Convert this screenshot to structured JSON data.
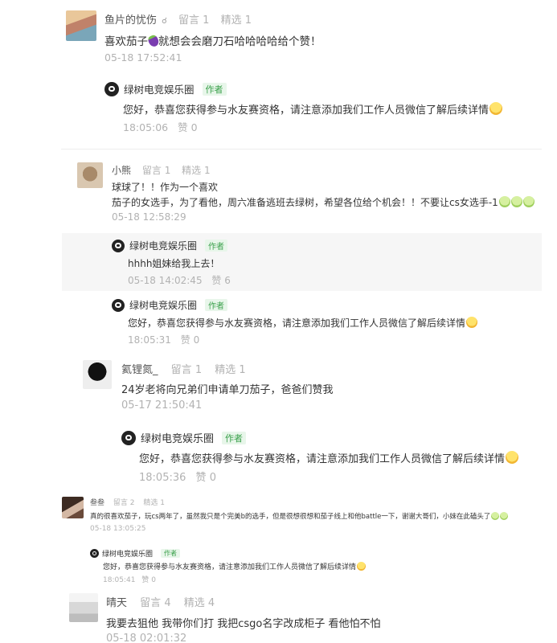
{
  "labels": {
    "comment_count_prefix": "留言",
    "featured_prefix": "精选",
    "like_prefix": "赞"
  },
  "colors": {
    "author_tag_green": "#3aa04b",
    "meta_gray": "#b2b2b2",
    "highlight_bg": "#f6f6f6"
  },
  "comments": [
    {
      "nickname": "鱼片的忧伤",
      "nickname_badge": "glasses-icon",
      "comment_count": "1",
      "featured_count": "1",
      "text": "喜欢茄子",
      "text_emoji": "eggplant-icon",
      "text_after": "就想会会磨刀石哈哈哈哈给个赞！",
      "time": "05-18 17:52:41",
      "replies": [
        {
          "author": "绿树电竞娱乐圈",
          "tag": "作者",
          "text": "您好，恭喜您获得参与水友赛资格，请注意添加我们工作人员微信了解后续详情",
          "time": "18:05:06",
          "likes": "0"
        }
      ]
    },
    {
      "nickname": "小熊",
      "comment_count": "1",
      "featured_count": "1",
      "text_line1": "球球了！！作为一个喜欢",
      "text_line2": "茄子的女选手，为了看他，周六准备逃班去绿树，希望各位给个机会！！不要让cs女选手-1",
      "time": "05-18 12:58:29",
      "replies": [
        {
          "author": "绿树电竞娱乐圈",
          "tag": "作者",
          "text": "hhhh姐妹给我上去！",
          "time": "05-18 14:02:45",
          "likes": "6"
        },
        {
          "author": "绿树电竞娱乐圈",
          "tag": "作者",
          "text": "您好，恭喜您获得参与水友赛资格，请注意添加我们工作人员微信了解后续详情",
          "time": "18:05:31",
          "likes": "0"
        }
      ]
    },
    {
      "nickname": "氦锂氮_",
      "comment_count": "1",
      "featured_count": "1",
      "text": "24岁老将向兄弟们申请单刀茄子，爸爸们赞我",
      "time": "05-17 21:50:41",
      "replies": [
        {
          "author": "绿树电竞娱乐圈",
          "tag": "作者",
          "text": "您好，恭喜您获得参与水友赛资格，请注意添加我们工作人员微信了解后续详情",
          "time": "18:05:36",
          "likes": "0"
        }
      ]
    },
    {
      "nickname": "叁叁",
      "comment_count": "2",
      "featured_count": "1",
      "text": "真的很喜欢茄子，玩cs两年了，虽然我只是个完美b的选手，但是很想很想和茄子线上和他battle一下，谢谢大哥们，小妹在此磕头了",
      "time": "05-18 13:05:25",
      "replies": [
        {
          "author": "绿树电竞娱乐圈",
          "tag": "作者",
          "text": "您好，恭喜您获得参与水友赛资格，请注意添加我们工作人员微信了解后续详情",
          "time": "18:05:41",
          "likes": "0"
        }
      ]
    },
    {
      "nickname": "晴天",
      "comment_count": "4",
      "featured_count": "4",
      "text": "我要去狙他 我带你们打 我把csgo名字改成柜子 看他怕不怕",
      "time": "05-18 02:01:32"
    }
  ]
}
